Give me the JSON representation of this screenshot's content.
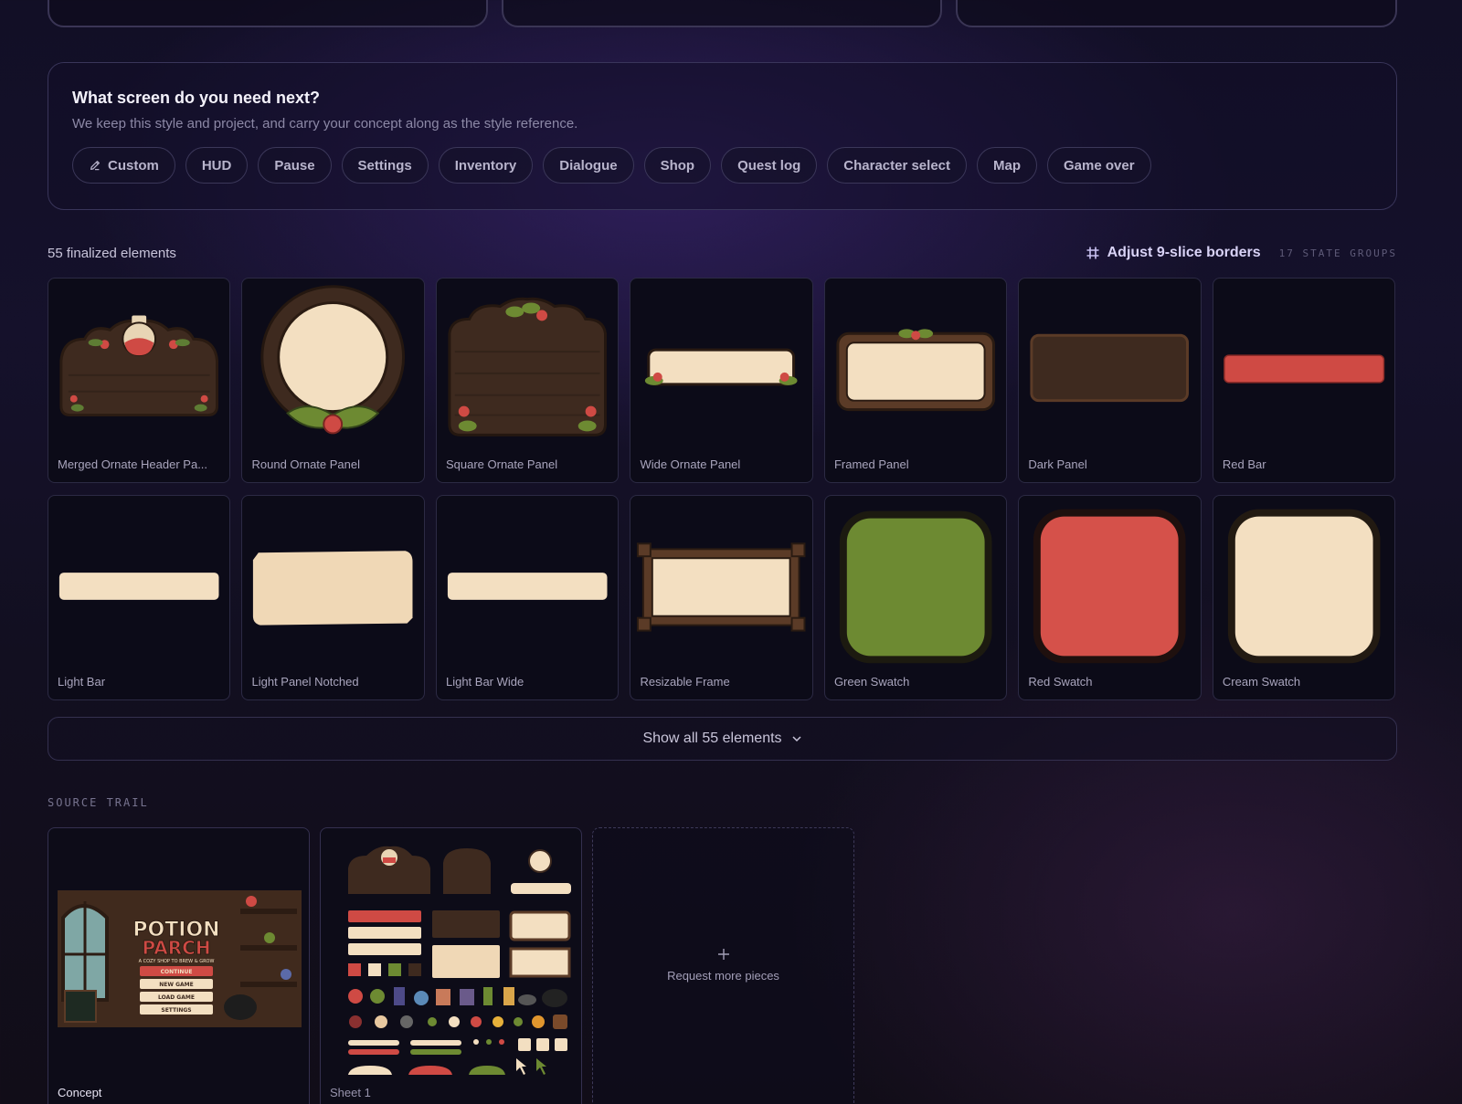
{
  "next": {
    "title": "What screen do you need next?",
    "subtitle": "We keep this style and project, and carry your concept along as the style reference.",
    "chips": [
      {
        "label": "Custom",
        "icon": "pencil-icon"
      },
      {
        "label": "HUD"
      },
      {
        "label": "Pause"
      },
      {
        "label": "Settings"
      },
      {
        "label": "Inventory"
      },
      {
        "label": "Dialogue"
      },
      {
        "label": "Shop"
      },
      {
        "label": "Quest log"
      },
      {
        "label": "Character select"
      },
      {
        "label": "Map"
      },
      {
        "label": "Game over"
      }
    ]
  },
  "elements": {
    "count_label": "55 finalized elements",
    "adjust_label": "Adjust 9-slice borders",
    "adjust_icon": "grid-hash-icon",
    "groups_label": "17 STATE GROUPS",
    "items": [
      {
        "label": "Merged Ornate Header Pa...",
        "art": "merged-header"
      },
      {
        "label": "Round Ornate Panel",
        "art": "round-ornate"
      },
      {
        "label": "Square Ornate Panel",
        "art": "square-ornate"
      },
      {
        "label": "Wide Ornate Panel",
        "art": "wide-ornate"
      },
      {
        "label": "Framed Panel",
        "art": "framed"
      },
      {
        "label": "Dark Panel",
        "art": "dark"
      },
      {
        "label": "Red Bar",
        "art": "red-bar"
      },
      {
        "label": "Light Bar",
        "art": "light-bar"
      },
      {
        "label": "Light Panel Notched",
        "art": "light-notched"
      },
      {
        "label": "Light Bar Wide",
        "art": "light-bar-wide"
      },
      {
        "label": "Resizable Frame",
        "art": "resizable"
      },
      {
        "label": "Green Swatch",
        "art": "swatch-green"
      },
      {
        "label": "Red Swatch",
        "art": "swatch-red"
      },
      {
        "label": "Cream Swatch",
        "art": "swatch-cream"
      }
    ],
    "show_all_label": "Show all 55 elements"
  },
  "trail": {
    "label": "SOURCE TRAIL",
    "cards": [
      {
        "name": "Concept"
      },
      {
        "name": "Sheet 1"
      },
      {
        "name": "Request more pieces"
      }
    ],
    "concept_art": {
      "title_1": "POTION",
      "title_2": "PARCH",
      "tagline": "A COZY SHOP TO BREW & GROW",
      "menu": [
        "CONTINUE",
        "NEW GAME",
        "LOAD GAME",
        "SETTINGS"
      ]
    }
  },
  "colors": {
    "wood": "#3e2a1f",
    "cream": "#f3dfc1",
    "red": "#cf4a44",
    "green": "#6d8a32",
    "leaf": "#5e7d34"
  }
}
